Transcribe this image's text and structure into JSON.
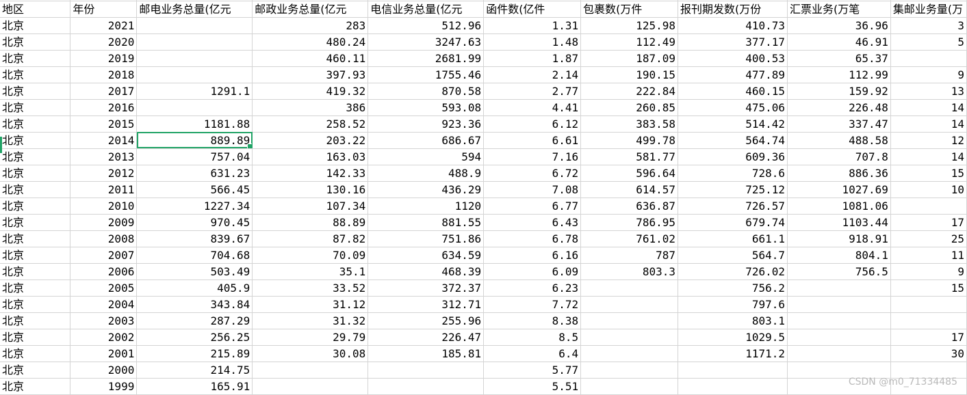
{
  "headers": [
    "地区",
    "年份",
    "邮电业务总量(亿元",
    "邮政业务总量(亿元",
    "电信业务总量(亿元",
    "函件数(亿件",
    "包裹数(万件",
    "报刊期发数(万份",
    "汇票业务(万笔",
    "集邮业务量(万"
  ],
  "rows": [
    [
      "北京",
      "2021",
      "",
      "283",
      "512.96",
      "1.31",
      "125.98",
      "410.73",
      "36.96",
      "3"
    ],
    [
      "北京",
      "2020",
      "",
      "480.24",
      "3247.63",
      "1.48",
      "112.49",
      "377.17",
      "46.91",
      "5"
    ],
    [
      "北京",
      "2019",
      "",
      "460.11",
      "2681.99",
      "1.87",
      "187.09",
      "400.53",
      "65.37",
      ""
    ],
    [
      "北京",
      "2018",
      "",
      "397.93",
      "1755.46",
      "2.14",
      "190.15",
      "477.89",
      "112.99",
      "9"
    ],
    [
      "北京",
      "2017",
      "1291.1",
      "419.32",
      "870.58",
      "2.77",
      "222.84",
      "460.15",
      "159.92",
      "13"
    ],
    [
      "北京",
      "2016",
      "",
      "386",
      "593.08",
      "4.41",
      "260.85",
      "475.06",
      "226.48",
      "14"
    ],
    [
      "北京",
      "2015",
      "1181.88",
      "258.52",
      "923.36",
      "6.12",
      "383.58",
      "514.42",
      "337.47",
      "14"
    ],
    [
      "北京",
      "2014",
      "889.89",
      "203.22",
      "686.67",
      "6.61",
      "499.78",
      "564.74",
      "488.58",
      "12"
    ],
    [
      "北京",
      "2013",
      "757.04",
      "163.03",
      "594",
      "7.16",
      "581.77",
      "609.36",
      "707.8",
      "14"
    ],
    [
      "北京",
      "2012",
      "631.23",
      "142.33",
      "488.9",
      "6.72",
      "596.64",
      "728.6",
      "886.36",
      "15"
    ],
    [
      "北京",
      "2011",
      "566.45",
      "130.16",
      "436.29",
      "7.08",
      "614.57",
      "725.12",
      "1027.69",
      "10"
    ],
    [
      "北京",
      "2010",
      "1227.34",
      "107.34",
      "1120",
      "6.77",
      "636.87",
      "726.57",
      "1081.06",
      ""
    ],
    [
      "北京",
      "2009",
      "970.45",
      "88.89",
      "881.55",
      "6.43",
      "786.95",
      "679.74",
      "1103.44",
      "17"
    ],
    [
      "北京",
      "2008",
      "839.67",
      "87.82",
      "751.86",
      "6.78",
      "761.02",
      "661.1",
      "918.91",
      "25"
    ],
    [
      "北京",
      "2007",
      "704.68",
      "70.09",
      "634.59",
      "6.16",
      "787",
      "564.7",
      "804.1",
      "11"
    ],
    [
      "北京",
      "2006",
      "503.49",
      "35.1",
      "468.39",
      "6.09",
      "803.3",
      "726.02",
      "756.5",
      "9"
    ],
    [
      "北京",
      "2005",
      "405.9",
      "33.52",
      "372.37",
      "6.23",
      "",
      "756.2",
      "",
      "15"
    ],
    [
      "北京",
      "2004",
      "343.84",
      "31.12",
      "312.71",
      "7.72",
      "",
      "797.6",
      "",
      ""
    ],
    [
      "北京",
      "2003",
      "287.29",
      "31.32",
      "255.96",
      "8.38",
      "",
      "803.1",
      "",
      ""
    ],
    [
      "北京",
      "2002",
      "256.25",
      "29.79",
      "226.47",
      "8.5",
      "",
      "1029.5",
      "",
      "17"
    ],
    [
      "北京",
      "2001",
      "215.89",
      "30.08",
      "185.81",
      "6.4",
      "",
      "1171.2",
      "",
      "30"
    ],
    [
      "北京",
      "2000",
      "214.75",
      "",
      "",
      "5.77",
      "",
      "",
      "",
      ""
    ],
    [
      "北京",
      "1999",
      "165.91",
      "",
      "",
      "5.51",
      "",
      "",
      "",
      ""
    ]
  ],
  "selected_cell": {
    "row": 7,
    "col": 2
  },
  "colors": {
    "grid": "#d4d4d4",
    "selection": "#21a366"
  },
  "watermark": "CSDN @m0_71334485"
}
